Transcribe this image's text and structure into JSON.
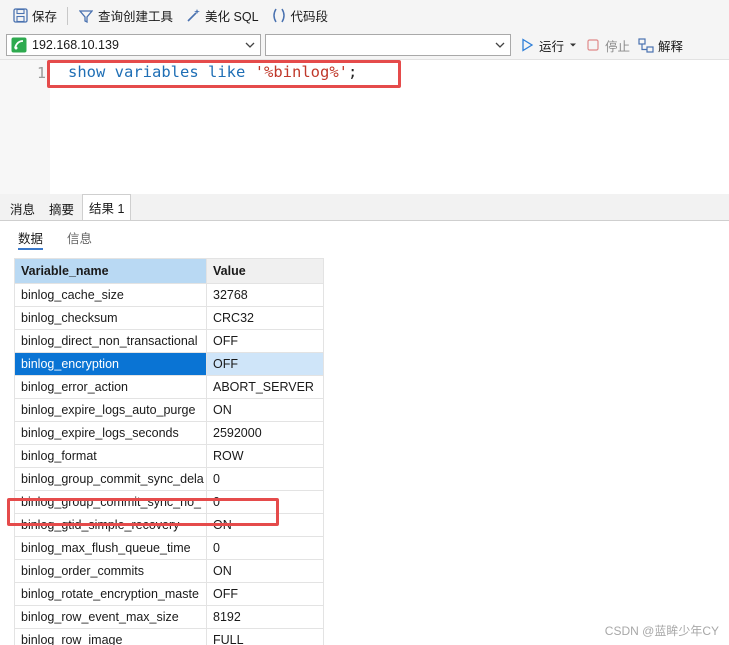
{
  "toolbar": {
    "save": "保存",
    "query_builder": "查询创建工具",
    "beautify": "美化 SQL",
    "snippet": "代码段"
  },
  "connection": {
    "host": "192.168.10.139",
    "database": "",
    "run": "运行",
    "stop": "停止",
    "explain": "解释"
  },
  "editor": {
    "line_number": "1",
    "kw_show": "show",
    "kw_variables": "variables",
    "kw_like": "like",
    "string": "'%binlog%'",
    "semicolon": ";"
  },
  "tabs": {
    "messages": "消息",
    "summary": "摘要",
    "result": "结果 1"
  },
  "subtabs": {
    "data": "数据",
    "info": "信息"
  },
  "grid": {
    "columns": [
      "Variable_name",
      "Value"
    ],
    "rows": [
      [
        "binlog_cache_size",
        "32768"
      ],
      [
        "binlog_checksum",
        "CRC32"
      ],
      [
        "binlog_direct_non_transactional",
        "OFF"
      ],
      [
        "binlog_encryption",
        "OFF"
      ],
      [
        "binlog_error_action",
        "ABORT_SERVER"
      ],
      [
        "binlog_expire_logs_auto_purge",
        "ON"
      ],
      [
        "binlog_expire_logs_seconds",
        "2592000"
      ],
      [
        "binlog_format",
        "ROW"
      ],
      [
        "binlog_group_commit_sync_dela",
        "0"
      ],
      [
        "binlog_group_commit_sync_no_",
        "0"
      ],
      [
        "binlog_gtid_simple_recovery",
        "ON"
      ],
      [
        "binlog_max_flush_queue_time",
        "0"
      ],
      [
        "binlog_order_commits",
        "ON"
      ],
      [
        "binlog_rotate_encryption_maste",
        "OFF"
      ],
      [
        "binlog_row_event_max_size",
        "8192"
      ],
      [
        "binlog_row_image",
        "FULL"
      ]
    ],
    "selected_row": 3
  },
  "watermark": "CSDN @蓝眸少年CY",
  "colors": {
    "highlight_box": "#e54b4b",
    "selection": "#0a74d4",
    "keyword": "#1f6fb5",
    "string": "#c0392b"
  }
}
